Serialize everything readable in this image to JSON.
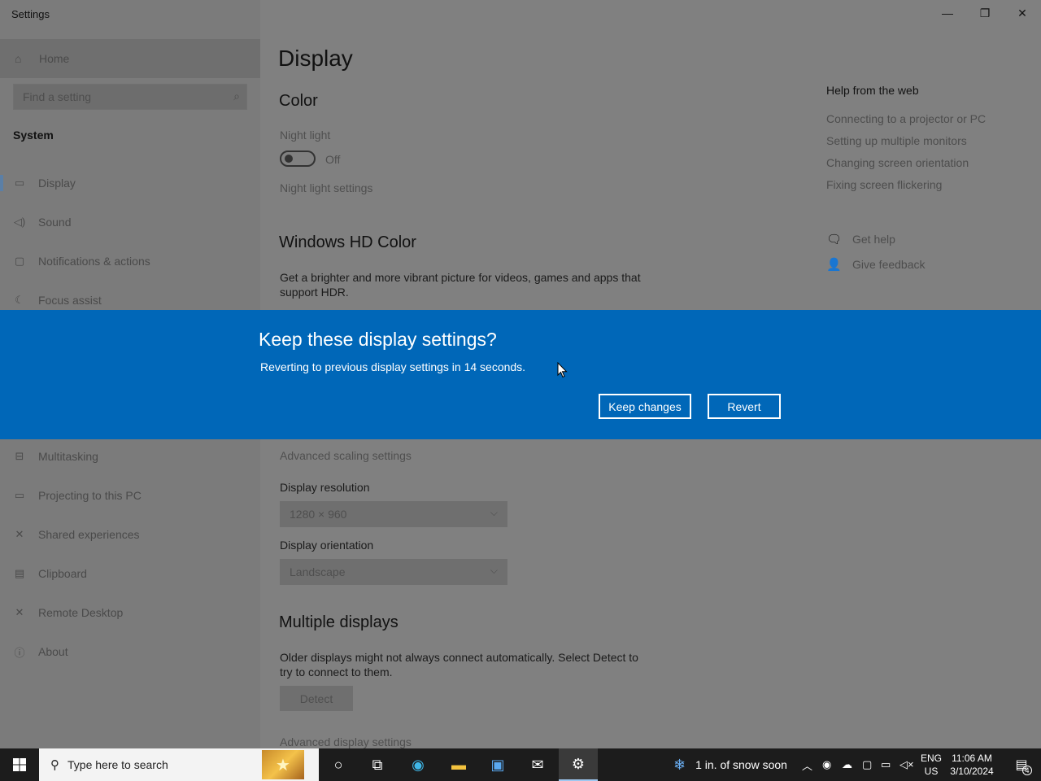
{
  "window": {
    "title": "Settings",
    "minimize_icon": "minimize-icon",
    "restore_icon": "restore-icon",
    "close_icon": "close-icon"
  },
  "sidebar": {
    "home_label": "Home",
    "search_placeholder": "Find a setting",
    "section": "System",
    "items": [
      {
        "label": "Display",
        "icon": "monitor-icon"
      },
      {
        "label": "Sound",
        "icon": "speaker-icon"
      },
      {
        "label": "Notifications & actions",
        "icon": "notification-icon"
      },
      {
        "label": "Focus assist",
        "icon": "moon-icon"
      },
      {
        "label": "Multitasking",
        "icon": "multitasking-icon"
      },
      {
        "label": "Projecting to this PC",
        "icon": "projector-icon"
      },
      {
        "label": "Shared experiences",
        "icon": "share-icon"
      },
      {
        "label": "Clipboard",
        "icon": "clipboard-icon"
      },
      {
        "label": "Remote Desktop",
        "icon": "remote-desktop-icon"
      },
      {
        "label": "About",
        "icon": "info-icon"
      }
    ]
  },
  "main": {
    "title": "Display",
    "color_heading": "Color",
    "night_light_label": "Night light",
    "night_light_state": "Off",
    "night_light_settings": "Night light settings",
    "hdr_heading": "Windows HD Color",
    "hdr_desc_1": "Get a brighter and more vibrant picture for videos, games and apps that",
    "hdr_desc_2": "support HDR.",
    "advanced_scaling": "Advanced scaling settings",
    "resolution_label": "Display resolution",
    "resolution_value": "1280 × 960",
    "orientation_label": "Display orientation",
    "orientation_value": "Landscape",
    "multi_heading": "Multiple displays",
    "multi_desc_1": "Older displays might not always connect automatically. Select Detect to",
    "multi_desc_2": "try to connect to them.",
    "detect_label": "Detect",
    "advanced_display": "Advanced display settings"
  },
  "help": {
    "title": "Help from the web",
    "links": [
      "Connecting to a projector or PC",
      "Setting up multiple monitors",
      "Changing screen orientation",
      "Fixing screen flickering"
    ],
    "get_help": "Get help",
    "give_feedback": "Give feedback"
  },
  "dialog": {
    "title": "Keep these display settings?",
    "message": "Reverting to previous display settings in 14 seconds.",
    "keep_label": "Keep changes",
    "revert_label": "Revert"
  },
  "taskbar": {
    "search_placeholder": "Type here to search",
    "weather": "1 in. of snow soon",
    "lang_1": "ENG",
    "lang_2": "US",
    "time": "11:06 AM",
    "date": "3/10/2024",
    "notification_count": "4"
  }
}
